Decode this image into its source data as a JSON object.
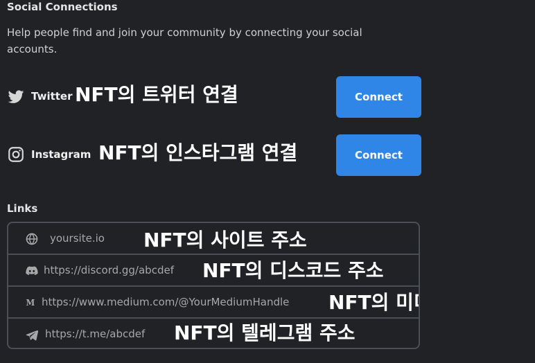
{
  "sections": {
    "social_connections": {
      "title": "Social Connections",
      "description": "Help people find and join your community by connecting your social accounts."
    },
    "social": [
      {
        "platform": "Twitter",
        "overlay": "NFT의 트위터 연결",
        "button_label": "Connect",
        "icon": "twitter-icon"
      },
      {
        "platform": "Instagram",
        "overlay": "NFT의 인스타그램 연결",
        "button_label": "Connect",
        "icon": "instagram-icon"
      }
    ],
    "links": {
      "title": "Links",
      "items": [
        {
          "icon": "globe-icon",
          "placeholder": "yoursite.io",
          "caption": "NFT의 사이트 주소"
        },
        {
          "icon": "discord-icon",
          "placeholder": "https://discord.gg/abcdef",
          "caption": "NFT의 디스코드 주소"
        },
        {
          "icon": "medium-icon",
          "placeholder": "https://www.medium.com/@YourMediumHandle",
          "caption": "NFT의 미디엄 주소"
        },
        {
          "icon": "telegram-icon",
          "placeholder": "https://t.me/abcdef",
          "caption": "NFT의 텔레그램 주소"
        }
      ]
    }
  },
  "colors": {
    "background": "#202225",
    "primary_button": "#2f86e6",
    "border": "#4b4f55",
    "text": "#e7e7e7",
    "placeholder": "#a8a8a8"
  }
}
